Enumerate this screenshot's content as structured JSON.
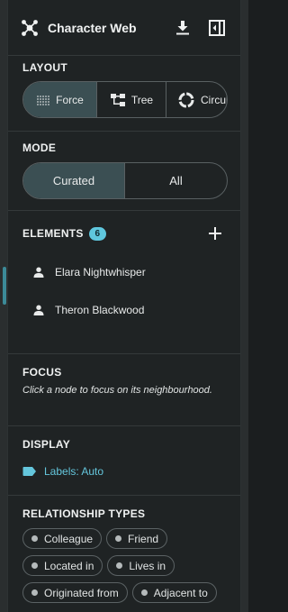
{
  "header": {
    "title": "Character Web",
    "logo_icon": "network-icon",
    "download_icon": "download-icon",
    "collapse_icon": "sidebar-collapse-icon"
  },
  "layout": {
    "title": "LAYOUT",
    "options": [
      {
        "label": "Force",
        "icon": "force-grid-icon",
        "selected": true
      },
      {
        "label": "Tree",
        "icon": "tree-icon",
        "selected": false
      },
      {
        "label": "Circular",
        "icon": "circle-icon",
        "selected": false
      }
    ]
  },
  "mode": {
    "title": "MODE",
    "options": [
      {
        "label": "Curated",
        "selected": true
      },
      {
        "label": "All",
        "selected": false
      }
    ]
  },
  "elements": {
    "title": "ELEMENTS",
    "count": "6",
    "add_icon": "plus-icon",
    "items": [
      {
        "label": "Elara Nightwhisper",
        "icon": "person-icon"
      },
      {
        "label": "Theron Blackwood",
        "icon": "person-icon"
      }
    ]
  },
  "focus": {
    "title": "FOCUS",
    "text": "Click a node to focus on its neighbourhood."
  },
  "display": {
    "title": "DISPLAY",
    "labels": "Labels: Auto",
    "icon": "label-tag-icon"
  },
  "relationships": {
    "title": "RELATIONSHIP TYPES",
    "types": [
      "Colleague",
      "Friend",
      "Located in",
      "Lives in",
      "Originated from",
      "Adjacent to"
    ]
  },
  "colors": {
    "accent": "#5fc7de",
    "selected_segment": "#3b4f53",
    "panel_bg": "#1f2324",
    "active_marker": "#3c8a98"
  }
}
